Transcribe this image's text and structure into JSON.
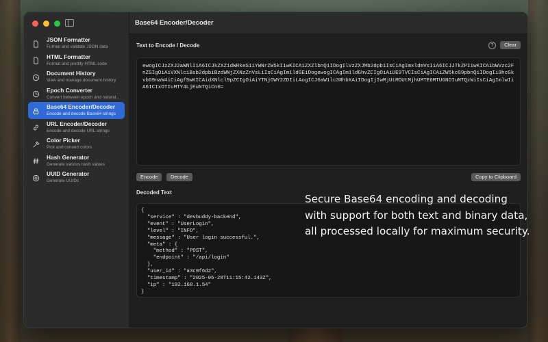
{
  "window": {
    "title": "Base64 Encoder/Decoder"
  },
  "sidebar": {
    "items": [
      {
        "title": "JSON Formatter",
        "desc": "Format and validate JSON data",
        "icon": "document-icon"
      },
      {
        "title": "HTML Formatter",
        "desc": "Format and prettify HTML code",
        "icon": "document-icon"
      },
      {
        "title": "Document History",
        "desc": "View and manage document history",
        "icon": "history-icon"
      },
      {
        "title": "Epoch Converter",
        "desc": "Convert between epoch and natural...",
        "icon": "clock-icon"
      },
      {
        "title": "Base64 Encoder/Decoder",
        "desc": "Encode and decode Base64 strings",
        "icon": "lock-icon"
      },
      {
        "title": "URL Encoder/Decoder",
        "desc": "Encode and decode URL strings",
        "icon": "link-icon"
      },
      {
        "title": "Color Picker",
        "desc": "Pick and convert colors",
        "icon": "eyedropper-icon"
      },
      {
        "title": "Hash Generator",
        "desc": "Generate various hash values",
        "icon": "hash-icon"
      },
      {
        "title": "UUID Generator",
        "desc": "Generate UUIDs",
        "icon": "uuid-icon"
      }
    ],
    "active_index": 4
  },
  "encode": {
    "label": "Text to Encode / Decode",
    "help": "?",
    "clear_label": "Clear",
    "value": "ewogICJzZXJ2aWNlIiA6ICJkZXZidWRkeS1iYWNrZW5kIiwKICAiZXZlbnQiIDogIlVzZXJMb2dpbiIsCiAgImxldmVsIiA6ICJJTkZPIiwKICAibWVzc2FnZSIgOiAiVXNlciBsb2dpbiBzdWNjZXNzZnVsLiIsCiAgIm1ldGEiDogewogICAgIm1ldGhvZCIgOiAiUE9TVCIsCiAgICAiZW5kcG9pbnQiIDogIi9hcGkvbG9naW4iCiAgfSwKICAidXNlcl9pZCIgOiAiYTNjOWY2ZDIiLAogICJ0aW1lc3RhbXAiIDogIjIwMjUtMDUtMjhUMTE6MTU6NDIuMTQzWiIsCiAgImlwIiA6ICIxOTIuMTY4LjEuNTQiCn0=",
    "encode_label": "Encode",
    "decode_label": "Decode",
    "copy_label": "Copy to Clipboard"
  },
  "decoded": {
    "label": "Decoded Text",
    "value": "{\n  \"service\" : \"devbuddy-backend\",\n  \"event\" : \"UserLogin\",\n  \"level\" : \"INFO\",\n  \"message\" : \"User login successful.\",\n  \"meta\" : {\n    \"method\" : \"POST\",\n    \"endpoint\" : \"/api/login\"\n  },\n  \"user_id\" : \"a3c9f6d2\",\n  \"timestamp\" : \"2025-05-28T11:15:42.143Z\",\n  \"ip\" : \"192.168.1.54\"\n}"
  },
  "caption": "Secure Base64 encoding and decoding with support for both text and binary data, all processed locally for maximum security."
}
